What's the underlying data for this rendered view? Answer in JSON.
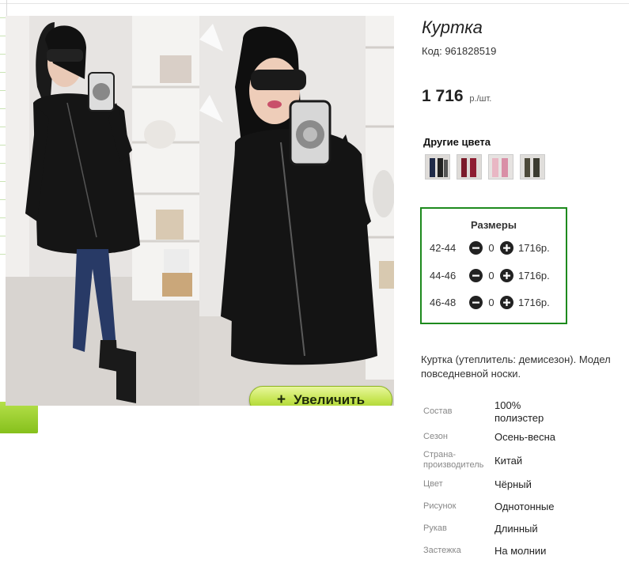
{
  "product": {
    "title": "Куртка",
    "code": "Код: 961828519",
    "price": "1 716",
    "price_unit": "р./шт.",
    "zoom_button": {
      "icon": "+",
      "label": "Увеличить"
    }
  },
  "other_colors": {
    "title": "Другие цвета",
    "swatches": [
      {
        "name": "navy-swatch",
        "color": "#1f2a48"
      },
      {
        "name": "burgundy-swatch",
        "color": "#7a1a2a"
      },
      {
        "name": "pink-swatch",
        "color": "#e9b7c4"
      },
      {
        "name": "khaki-swatch",
        "color": "#4d4a3a"
      }
    ]
  },
  "sizes": {
    "title": "Размеры",
    "rows": [
      {
        "size": "42-44",
        "qty": "0",
        "price": "1716р."
      },
      {
        "size": "44-46",
        "qty": "0",
        "price": "1716р."
      },
      {
        "size": "46-48",
        "qty": "0",
        "price": "1716р."
      }
    ]
  },
  "description": {
    "line1": "Куртка (утеплитель: демисезон). Модел",
    "line2": "повседневной носки."
  },
  "specs": [
    {
      "label": "Состав",
      "value_line1": "100%",
      "value_line2": "полиэстер"
    },
    {
      "label": "Сезон",
      "value_line1": "Осень-весна"
    },
    {
      "label_line1": "Страна-",
      "label_line2": "производитель",
      "value_line1": "Китай"
    },
    {
      "label": "Цвет",
      "value_line1": "Чёрный"
    },
    {
      "label": "Рисунок",
      "value_line1": "Однотонные"
    },
    {
      "label": "Рукав",
      "value_line1": "Длинный"
    },
    {
      "label": "Застежка",
      "value_line1": "На молнии"
    }
  ],
  "accent_colors": {
    "green_border": "#1d8a1d",
    "button_green": "#c6e552"
  }
}
